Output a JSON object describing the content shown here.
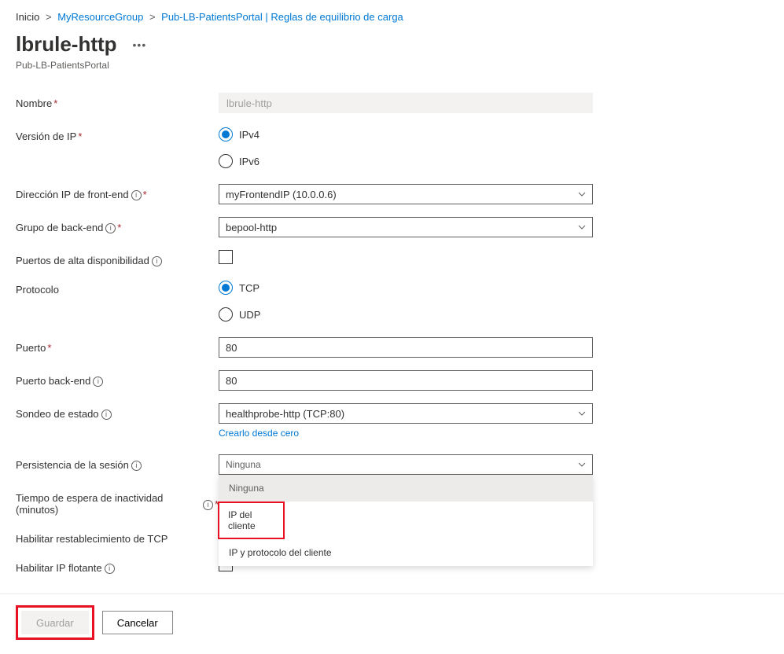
{
  "breadcrumb": {
    "home": "Inicio",
    "rg": "MyResourceGroup",
    "lb": "Pub-LB-PatientsPortal",
    "section": "Reglas de equilibrio de carga"
  },
  "header": {
    "title": "lbrule-http",
    "subtitle": "Pub-LB-PatientsPortal"
  },
  "labels": {
    "name": "Nombre",
    "ipversion": "Versión de IP",
    "frontendip": "Dirección IP de front-end",
    "backendpool": "Grupo de back-end",
    "haports": "Puertos de alta disponibilidad",
    "protocol": "Protocolo",
    "port": "Puerto",
    "backendport": "Puerto back-end",
    "healthprobe": "Sondeo de estado",
    "session": "Persistencia de la sesión",
    "idle": "Tiempo de espera de inactividad (minutos)",
    "tcpreset": "Habilitar restablecimiento de TCP",
    "floating": "Habilitar IP flotante"
  },
  "values": {
    "name": "lbrule-http",
    "ipv4": "IPv4",
    "ipv6": "IPv6",
    "frontend": "myFrontendIP (10.0.0.6)",
    "backend": "bepool-http",
    "tcp": "TCP",
    "udp": "UDP",
    "port": "80",
    "backendport": "80",
    "healthprobe": "healthprobe-http (TCP:80)",
    "healthprobe_create": "Crearlo desde cero",
    "session_selected": "Ninguna"
  },
  "session_options": {
    "none": "Ninguna",
    "clientip": "IP del cliente",
    "clientip_proto": "IP y protocolo del cliente"
  },
  "footer": {
    "save": "Guardar",
    "cancel": "Cancelar"
  }
}
